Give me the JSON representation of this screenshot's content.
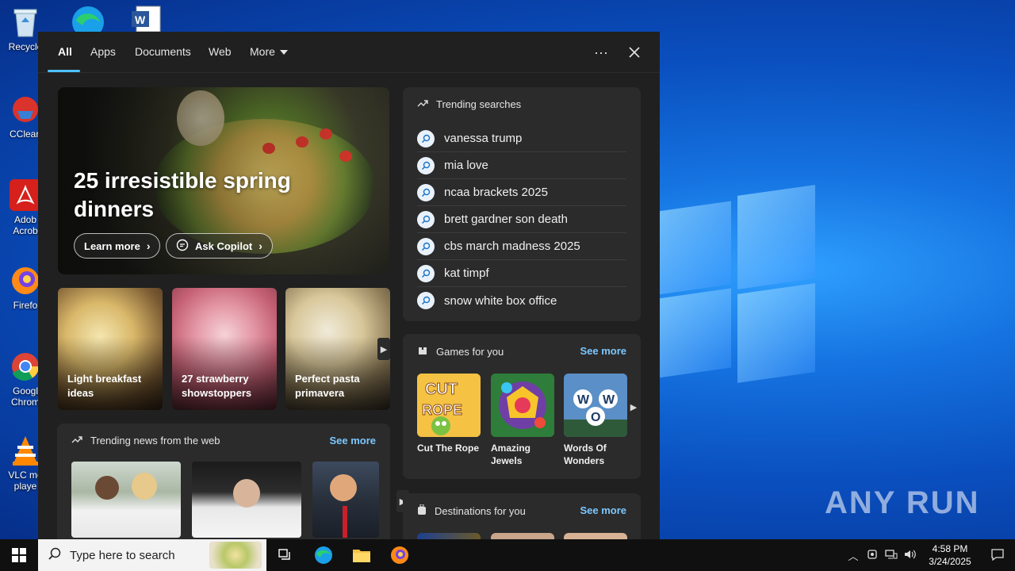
{
  "desktop": {
    "icons": [
      {
        "label": "Recycle",
        "icon": "recycle-bin-icon"
      },
      {
        "label": "CClean",
        "icon": "ccleaner-icon"
      },
      {
        "label": "Adob Acrob",
        "icon": "acrobat-icon"
      },
      {
        "label": "Firefo",
        "icon": "firefox-icon"
      },
      {
        "label": "Googl Chrom",
        "icon": "chrome-icon"
      },
      {
        "label": "VLC me playe",
        "icon": "vlc-icon"
      }
    ],
    "watermark": "ANY RUN"
  },
  "flyout": {
    "tabs": [
      {
        "label": "All",
        "active": true
      },
      {
        "label": "Apps"
      },
      {
        "label": "Documents"
      },
      {
        "label": "Web"
      },
      {
        "label": "More"
      }
    ],
    "more_options_icon": "ellipsis-icon",
    "close_icon": "close-icon"
  },
  "hero": {
    "title": "25 irresistible spring dinners",
    "learn_more": "Learn more",
    "ask_copilot": "Ask Copilot"
  },
  "stories": [
    {
      "label": "Light breakfast ideas"
    },
    {
      "label": "27 strawberry showstoppers"
    },
    {
      "label": "Perfect pasta primavera"
    }
  ],
  "trending_news": {
    "title": "Trending news from the web",
    "see_more": "See more"
  },
  "trending_searches": {
    "title": "Trending searches",
    "items": [
      "vanessa trump",
      "mia love",
      "ncaa brackets 2025",
      "brett gardner son death",
      "cbs march madness 2025",
      "kat timpf",
      "snow white box office"
    ]
  },
  "games": {
    "title": "Games for you",
    "see_more": "See more",
    "items": [
      {
        "name": "Cut The Rope"
      },
      {
        "name": "Amazing Jewels"
      },
      {
        "name": "Words Of Wonders"
      }
    ]
  },
  "destinations": {
    "title": "Destinations for you",
    "see_more": "See more"
  },
  "taskbar": {
    "search_placeholder": "Type here to search",
    "time": "4:58 PM",
    "date": "3/24/2025"
  }
}
